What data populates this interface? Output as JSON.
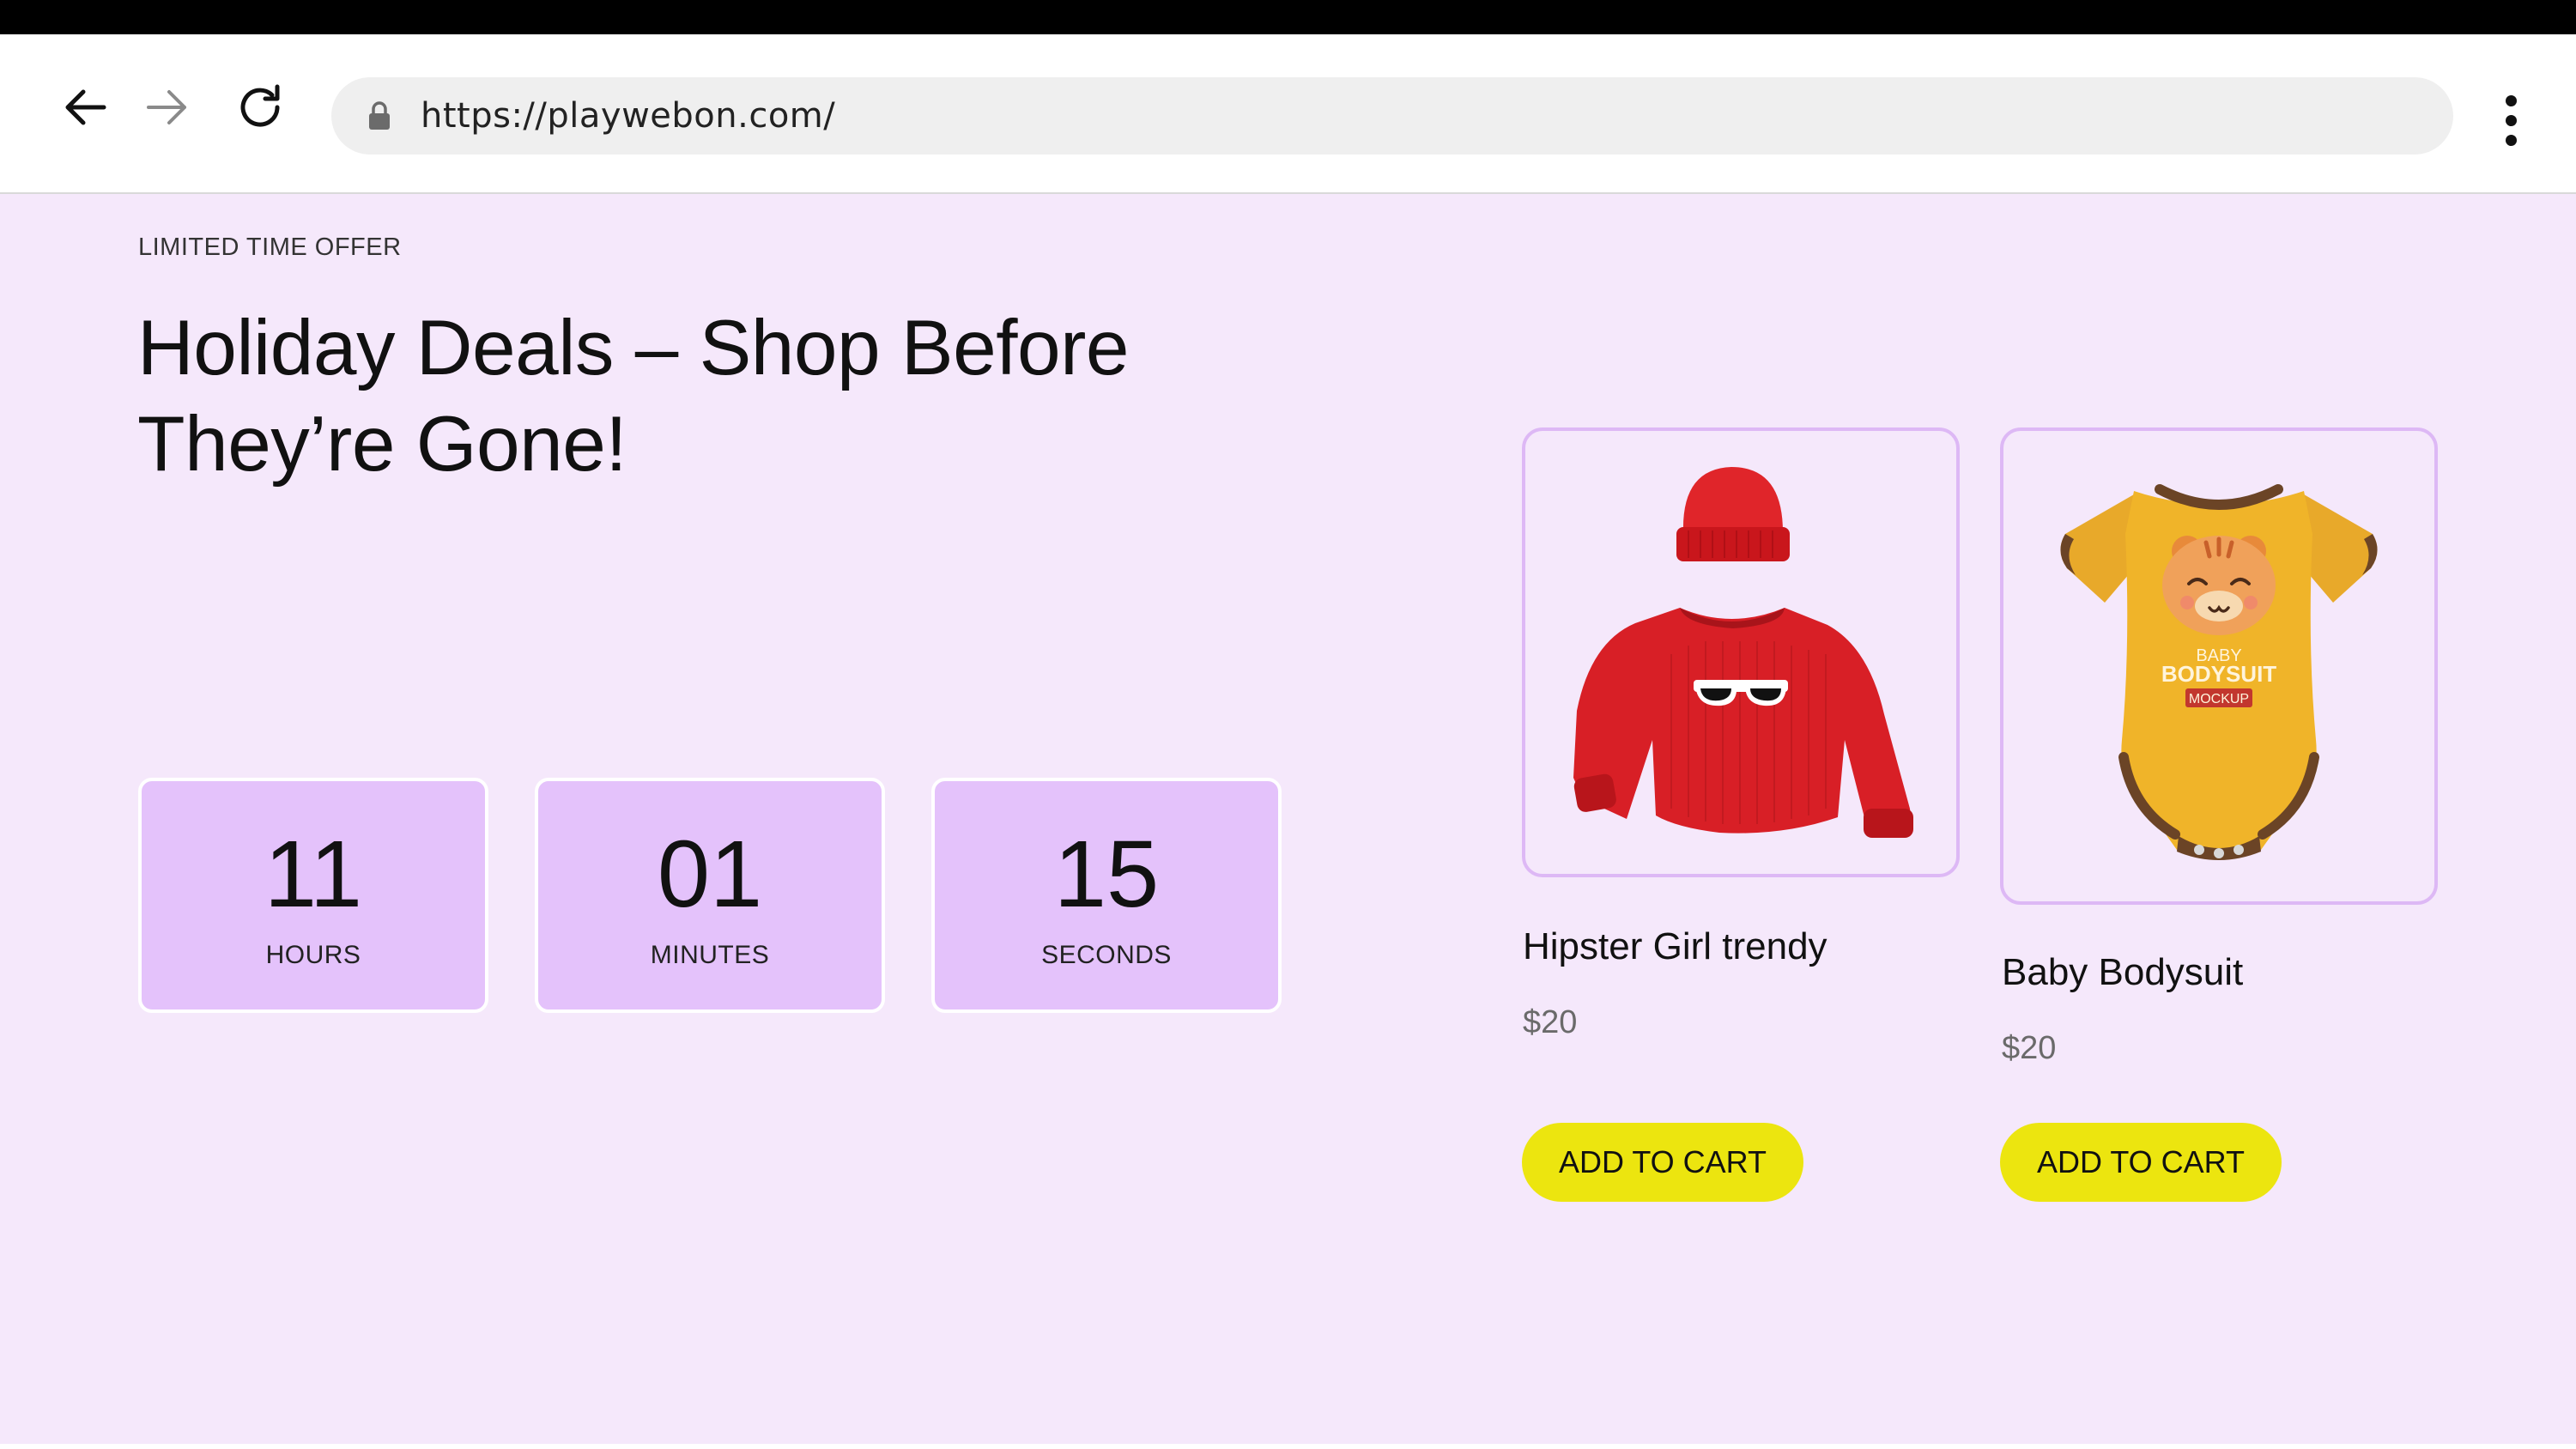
{
  "browser": {
    "url": "https://playwebon.com/"
  },
  "promo": {
    "eyebrow": "LIMITED TIME OFFER",
    "headline": "Holiday Deals – Shop Before They’re Gone!"
  },
  "countdown": [
    {
      "value": "11",
      "unit": "HOURS"
    },
    {
      "value": "01",
      "unit": "MINUTES"
    },
    {
      "value": "15",
      "unit": "SECONDS"
    }
  ],
  "products": [
    {
      "title": "Hipster Girl trendy",
      "price": "$20",
      "button": "ADD TO CART"
    },
    {
      "title": "Baby Bodysuit",
      "price": "$20",
      "button": "ADD TO CART",
      "image_text": [
        "BABY",
        "BODYSUIT",
        "MOCKUP"
      ]
    }
  ],
  "colors": {
    "page_background": "#f5e8fb",
    "countdown_box": "#e4c2fb",
    "card_border": "#ddb8f5",
    "cart_button": "#ece50f"
  }
}
